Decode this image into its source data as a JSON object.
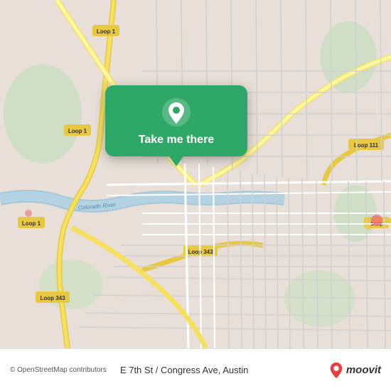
{
  "map": {
    "background_color": "#e8e0d8",
    "alt": "OpenStreetMap of Austin area"
  },
  "popup": {
    "button_label": "Take me there",
    "background_color": "#2ea866",
    "pin_color": "#ffffff"
  },
  "bottom_bar": {
    "copyright": "© OpenStreetMap contributors",
    "location": "E 7th St / Congress Ave, Austin",
    "logo_text": "moovit"
  }
}
